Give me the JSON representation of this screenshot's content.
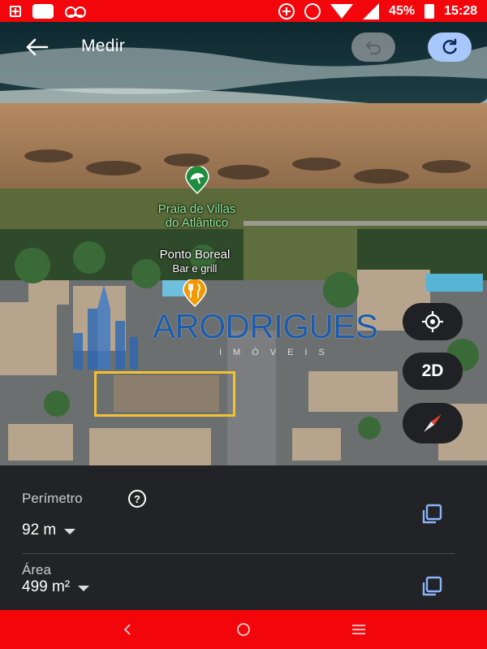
{
  "status_bar": {
    "battery_percent": "45%",
    "time": "15:28",
    "icons": [
      "pharmacy-icon",
      "message-icon",
      "voicemail-icon",
      "data-saver-icon",
      "alarm-icon",
      "wifi-icon",
      "signal-icon",
      "battery-icon"
    ]
  },
  "toolbar": {
    "title": "Medir",
    "back_icon": "arrow-left-icon",
    "undo_icon": "undo-icon",
    "redo_icon": "redo-icon"
  },
  "map": {
    "pois": {
      "beach_line1": "Praia de Villas",
      "beach_line2": "do Atlântico",
      "restaurant_name": "Ponto Boreal",
      "restaurant_sub": "Bar e grill"
    },
    "watermark": {
      "text": "ARODRIGUES",
      "sub": "IMÓVEIS"
    },
    "buttons": {
      "mode_label": "2D",
      "locate_icon": "my-location-icon",
      "compass_icon": "compass-icon"
    },
    "colors": {
      "lot_outline": "#f1c232",
      "beach_pin": "#1e8e3e",
      "restaurant_pin": "#f29900"
    }
  },
  "sheet": {
    "perimeter_label": "Perímetro",
    "perimeter_value": "92 m",
    "area_label": "Área",
    "area_value": "499 m²"
  },
  "nav_bar": {
    "icons": [
      "back-nav-icon",
      "home-nav-icon",
      "menu-nav-icon"
    ]
  }
}
